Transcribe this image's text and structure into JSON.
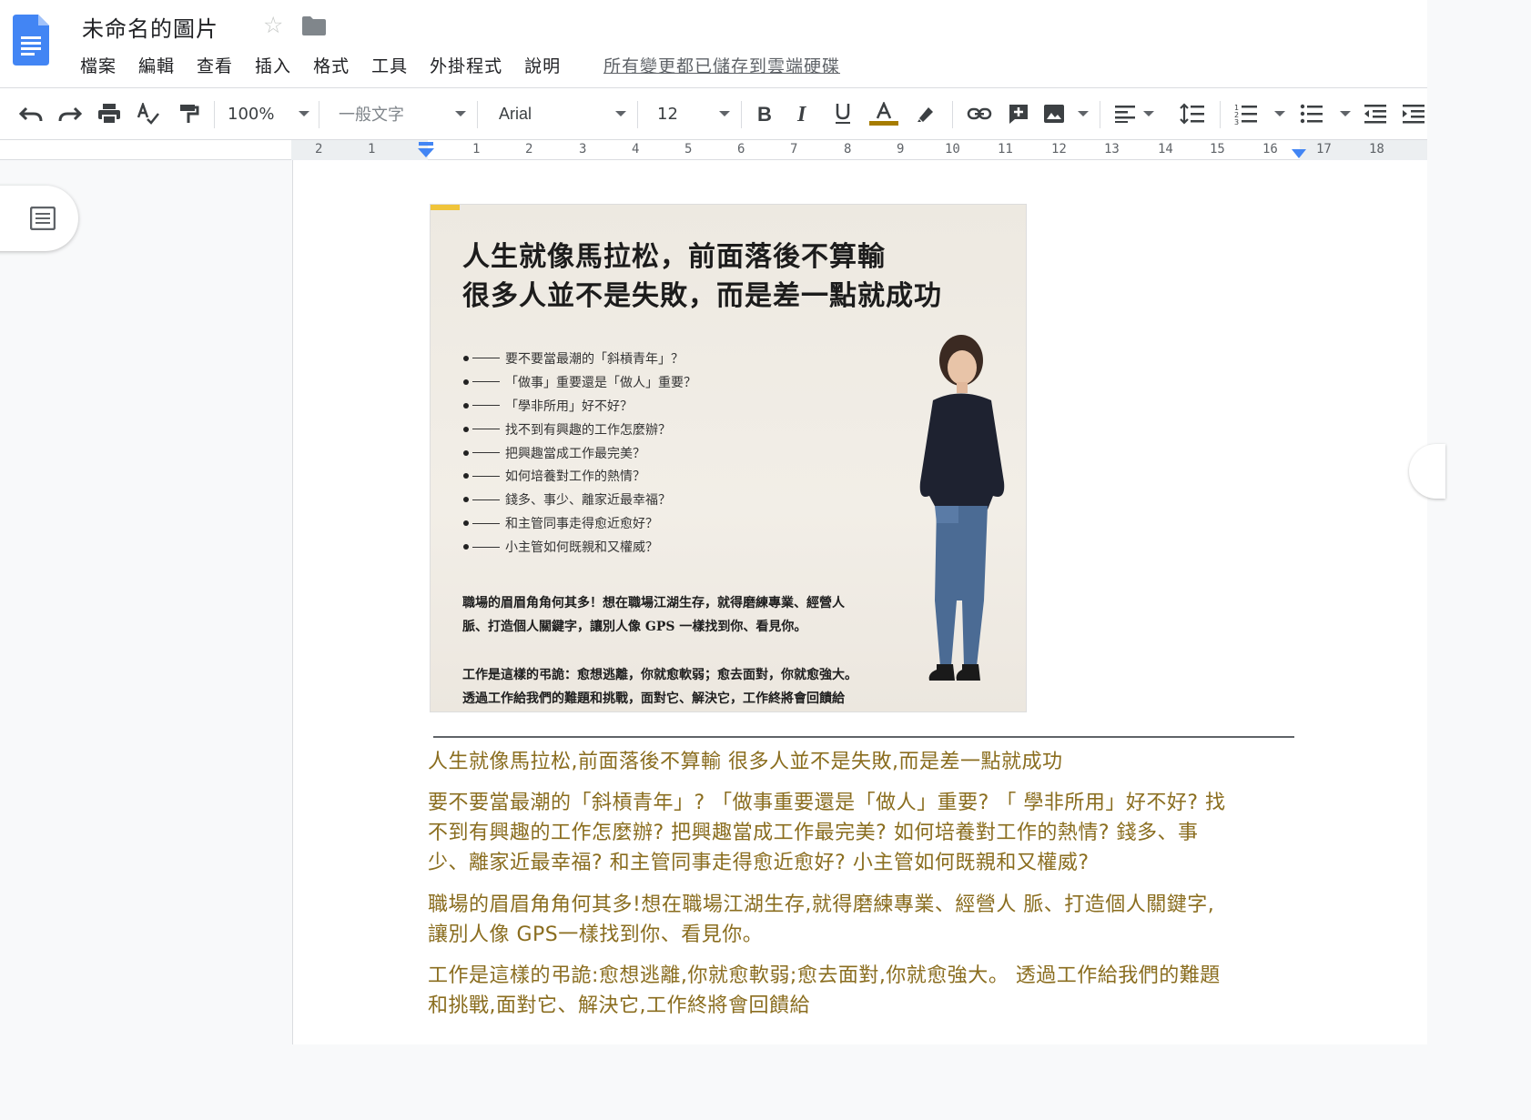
{
  "doc": {
    "title": "未命名的圖片",
    "saved_status": "所有變更都已儲存到雲端硬碟"
  },
  "menu": [
    "檔案",
    "編輯",
    "查看",
    "插入",
    "格式",
    "工具",
    "外掛程式",
    "說明"
  ],
  "toolbar": {
    "zoom": "100%",
    "style": "一般文字",
    "font": "Arial",
    "font_size": "12",
    "text_color_bar": "#a67c00"
  },
  "ruler": {
    "left_numbers": [
      "2",
      "1"
    ],
    "numbers": [
      "1",
      "2",
      "3",
      "4",
      "5",
      "6",
      "7",
      "8",
      "9",
      "10",
      "11",
      "12",
      "13",
      "14",
      "15",
      "16",
      "17",
      "18"
    ]
  },
  "image": {
    "headline_1": "人生就像馬拉松，前面落後不算輸",
    "headline_2": "很多人並不是失敗，而是差一點就成功",
    "bullets": [
      "要不要當最潮的「斜槓青年」？",
      "「做事」重要還是「做人」重要？",
      "「學非所用」好不好？",
      "找不到有興趣的工作怎麼辦？",
      "把興趣當成工作最完美？",
      "如何培養對工作的熱情？",
      "錢多、事少、離家近最幸福？",
      "和主管同事走得愈近愈好？",
      "小主管如何既親和又權威？"
    ],
    "para1_line1": "職場的眉眉角角何其多！想在職場江湖生存，就得磨練專業、經營人",
    "para1_line2": "脈、打造個人關鍵字，讓別人像 GPS 一樣找到你、看見你。",
    "para2_line1": "工作是這樣的弔詭：愈想逃離，你就愈軟弱；愈去面對，你就愈強大。",
    "para2_line2": "透過工作給我們的難題和挑戰，面對它、解決它，工作終將會回饋給"
  },
  "body": {
    "p1": "人生就像馬拉松,前面落後不算輸 很多人並不是失敗,而是差一點就成功",
    "p2_l1": "要不要當最潮的「斜槓青年」? 「做事重要還是「做人」重要? 「 學非所用」好不好? 找",
    "p2_l2": "不到有興趣的工作怎麼辦? 把興趣當成工作最完美? 如何培養對工作的熱情? 錢多、事",
    "p2_l3": "少、離家近最幸福? 和主管同事走得愈近愈好? 小主管如何既親和又權威?",
    "p3_l1": "職場的眉眉角角何其多!想在職場江湖生存,就得磨練專業、經營人 脈、打造個人關鍵字,",
    "p3_l2": "讓別人像 GPS一樣找到你、看見你。",
    "p4_l1": "工作是這樣的弔詭:愈想逃離,你就愈軟弱;愈去面對,你就愈強大。 透過工作給我們的難題",
    "p4_l2": "和挑戰,面對它、解決它,工作終將會回饋給"
  }
}
